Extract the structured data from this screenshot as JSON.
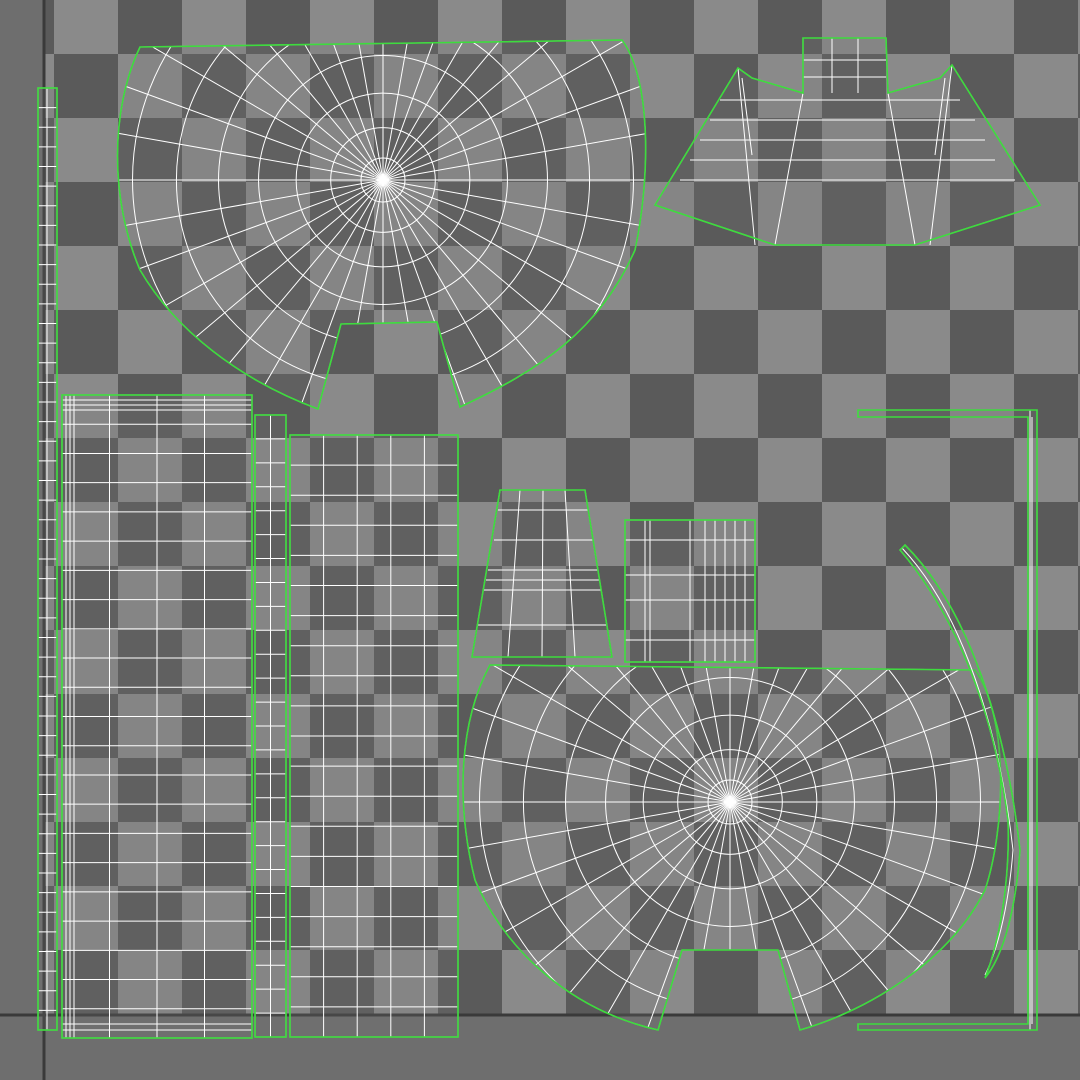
{
  "viewport": {
    "checker_light": "#8a8a8a",
    "checker_dark": "#5a5a5a",
    "background": "#6e6e6e",
    "axis_color": "#3a3a3a",
    "wire_color": "#ffffff",
    "border_color": "#3ddc3d"
  },
  "uv_shells": [
    {
      "id": "cap-top",
      "kind": "radial-fan"
    },
    {
      "id": "cap-bottom",
      "kind": "radial-fan"
    },
    {
      "id": "flared-strip",
      "kind": "flared-trapezoid"
    },
    {
      "id": "long-thin-strip",
      "kind": "strip"
    },
    {
      "id": "stacked-strip-left",
      "kind": "grid"
    },
    {
      "id": "narrow-strip",
      "kind": "strip"
    },
    {
      "id": "tall-grid",
      "kind": "grid"
    },
    {
      "id": "trapezoid-small",
      "kind": "trapezoid"
    },
    {
      "id": "square-small",
      "kind": "grid"
    },
    {
      "id": "corner-bracket",
      "kind": "strip"
    },
    {
      "id": "curved-sliver",
      "kind": "arc"
    }
  ]
}
